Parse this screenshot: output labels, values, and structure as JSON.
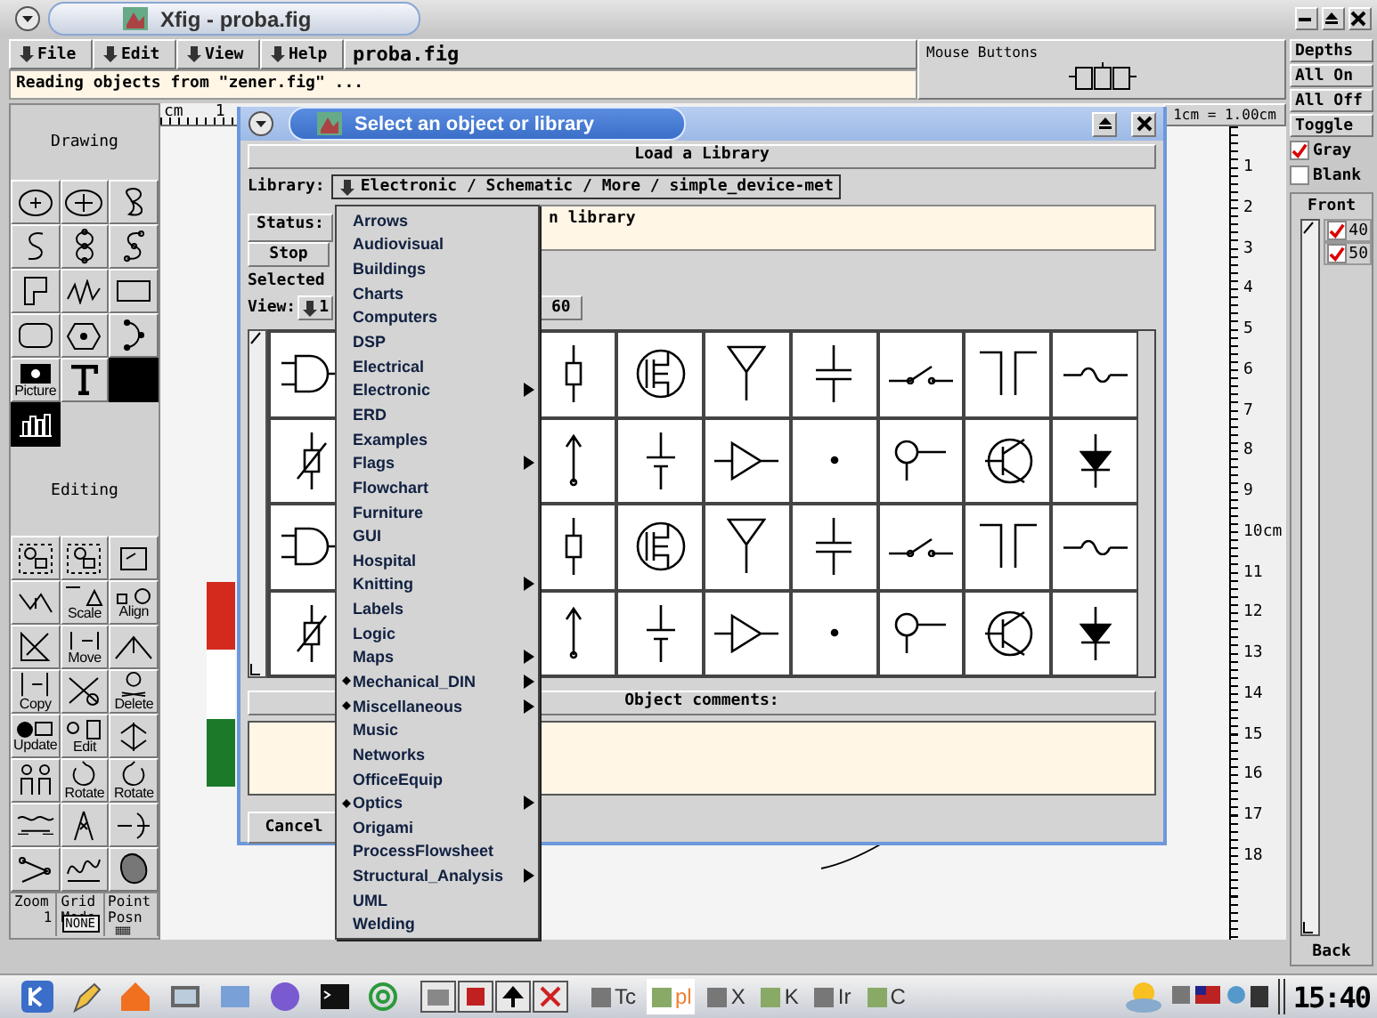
{
  "window": {
    "title": "Xfig - proba.fig"
  },
  "menu_bar": [
    {
      "label": "File"
    },
    {
      "label": "Edit"
    },
    {
      "label": "View"
    },
    {
      "label": "Help"
    }
  ],
  "filename": "proba.fig",
  "message": "Reading objects from \"zener.fig\" ...",
  "mouse_buttons": {
    "title": "Mouse Buttons"
  },
  "drawing_panel": {
    "title": "Drawing",
    "tools": [
      {
        "selected": false
      },
      {
        "selected": false
      },
      {
        "selected": false
      },
      {
        "selected": false
      },
      {
        "selected": false
      },
      {
        "selected": false
      },
      {
        "selected": false
      },
      {
        "selected": false
      },
      {
        "selected": false
      },
      {
        "selected": false
      },
      {
        "selected": false
      },
      {
        "selected": false
      },
      {
        "label": "Picture",
        "selected": false
      },
      {
        "selected": false
      },
      {
        "selected": true
      }
    ]
  },
  "editing_panel": {
    "title": "Editing",
    "tools": [
      {
        "selected": false
      },
      {
        "selected": false
      },
      {
        "selected": false
      },
      {
        "selected": false
      },
      {
        "label": "Scale",
        "selected": false
      },
      {
        "label": "Align",
        "selected": false
      },
      {
        "selected": false
      },
      {
        "label": "Move",
        "selected": false
      },
      {
        "selected": false
      },
      {
        "label": "Copy",
        "selected": false
      },
      {
        "selected": false
      },
      {
        "label": "Delete",
        "selected": false
      },
      {
        "label": "Update",
        "selected": false
      },
      {
        "label": "Edit",
        "selected": false
      },
      {
        "selected": false
      },
      {
        "selected": false
      },
      {
        "label": "Rotate",
        "selected": false
      },
      {
        "label": "Rotate",
        "selected": false
      },
      {
        "selected": false
      },
      {
        "selected": false
      },
      {
        "selected": false
      },
      {
        "selected": false
      },
      {
        "selected": false
      },
      {
        "selected": false
      }
    ]
  },
  "indicators": [
    {
      "label": "Zoom",
      "value": "1"
    },
    {
      "label": "Grid Mode",
      "value": "NONE"
    },
    {
      "label": "Point Posn"
    }
  ],
  "canvas": {
    "scale": "1cm = 1.00cm",
    "top_ruler": [
      "cm",
      "1"
    ],
    "side_ruler": [
      "1",
      "2",
      "3",
      "4",
      "5",
      "6",
      "7",
      "8",
      "9",
      "10cm",
      "11",
      "12",
      "13",
      "14",
      "15",
      "16",
      "17",
      "18"
    ]
  },
  "depths": {
    "buttons": [
      "Depths",
      "All On",
      "All Off",
      "Toggle"
    ],
    "options": [
      {
        "label": "Gray",
        "checked": true
      },
      {
        "label": "Blank",
        "checked": false
      }
    ],
    "front": "Front",
    "layers": [
      {
        "label": "40",
        "checked": true
      },
      {
        "label": "50",
        "checked": true
      }
    ],
    "back": "Back"
  },
  "dialog": {
    "title": "Select an object or library",
    "header": "Load a Library",
    "library": {
      "label": "Library:",
      "value": "Electronic / Schematic / More / simple_device-met"
    },
    "status": {
      "label": "Status:",
      "value": "n library"
    },
    "stop": "Stop",
    "selected_label": "Selected",
    "view": {
      "label": "View:",
      "options": [
        "1",
        "60"
      ]
    },
    "comments_header": "Object comments:",
    "cancel": "Cancel"
  },
  "library_menu": {
    "items": [
      {
        "label": "Arrows",
        "submenu": false,
        "marked": false
      },
      {
        "label": "Audiovisual",
        "submenu": false,
        "marked": false
      },
      {
        "label": "Buildings",
        "submenu": false,
        "marked": false
      },
      {
        "label": "Charts",
        "submenu": false,
        "marked": false
      },
      {
        "label": "Computers",
        "submenu": false,
        "marked": false
      },
      {
        "label": "DSP",
        "submenu": false,
        "marked": false
      },
      {
        "label": "Electrical",
        "submenu": false,
        "marked": false
      },
      {
        "label": "Electronic",
        "submenu": true,
        "marked": false
      },
      {
        "label": "ERD",
        "submenu": false,
        "marked": false
      },
      {
        "label": "Examples",
        "submenu": false,
        "marked": false
      },
      {
        "label": "Flags",
        "submenu": true,
        "marked": false
      },
      {
        "label": "Flowchart",
        "submenu": false,
        "marked": false
      },
      {
        "label": "Furniture",
        "submenu": false,
        "marked": false
      },
      {
        "label": "GUI",
        "submenu": false,
        "marked": false
      },
      {
        "label": "Hospital",
        "submenu": false,
        "marked": false
      },
      {
        "label": "Knitting",
        "submenu": true,
        "marked": false
      },
      {
        "label": "Labels",
        "submenu": false,
        "marked": false
      },
      {
        "label": "Logic",
        "submenu": false,
        "marked": false
      },
      {
        "label": "Maps",
        "submenu": true,
        "marked": false
      },
      {
        "label": "Mechanical_DIN",
        "submenu": true,
        "marked": true
      },
      {
        "label": "Miscellaneous",
        "submenu": true,
        "marked": true
      },
      {
        "label": "Music",
        "submenu": false,
        "marked": false
      },
      {
        "label": "Networks",
        "submenu": false,
        "marked": false
      },
      {
        "label": "OfficeEquip",
        "submenu": false,
        "marked": false
      },
      {
        "label": "Optics",
        "submenu": true,
        "marked": true
      },
      {
        "label": "Origami",
        "submenu": false,
        "marked": false
      },
      {
        "label": "ProcessFlowsheet",
        "submenu": false,
        "marked": false
      },
      {
        "label": "Structural_Analysis",
        "submenu": true,
        "marked": false
      },
      {
        "label": "UML",
        "submenu": false,
        "marked": false
      },
      {
        "label": "Welding",
        "submenu": false,
        "marked": false
      }
    ]
  },
  "taskbar": {
    "tasks": [
      {
        "label": "Tc",
        "selected": false
      },
      {
        "label": "pl",
        "selected": true
      },
      {
        "label": "X",
        "selected": false
      },
      {
        "label": "K",
        "selected": false
      },
      {
        "label": "Ir",
        "selected": false
      },
      {
        "label": "C",
        "selected": false
      }
    ],
    "clock": "15:40"
  }
}
